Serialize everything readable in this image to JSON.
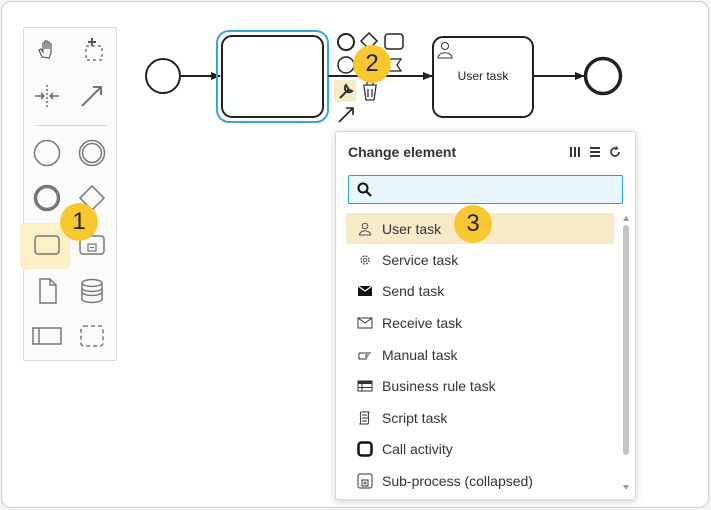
{
  "palette": {
    "tools": [
      {
        "name": "hand-tool",
        "icon": "hand-icon"
      },
      {
        "name": "lasso-tool",
        "icon": "lasso-icon"
      },
      {
        "name": "space-tool",
        "icon": "space-icon"
      },
      {
        "name": "connect-tool",
        "icon": "arrow-icon"
      },
      {
        "name": "start-event-tool",
        "icon": "circle-icon"
      },
      {
        "name": "intermediate-event-tool",
        "icon": "double-circle-icon"
      },
      {
        "name": "end-event-tool",
        "icon": "bold-circle-icon"
      },
      {
        "name": "gateway-tool",
        "icon": "diamond-icon"
      },
      {
        "name": "task-tool",
        "icon": "rounded-rect-icon"
      },
      {
        "name": "subprocess-tool",
        "icon": "collapsed-subprocess-icon"
      },
      {
        "name": "data-object-tool",
        "icon": "document-icon"
      },
      {
        "name": "data-store-tool",
        "icon": "database-icon"
      },
      {
        "name": "pool-tool",
        "icon": "pool-icon"
      },
      {
        "name": "group-tool",
        "icon": "group-icon"
      }
    ]
  },
  "callouts": {
    "one": "1",
    "two": "2",
    "three": "3"
  },
  "diagram": {
    "user_task_label": "User task"
  },
  "menu": {
    "title": "Change element",
    "search_value": "",
    "entries": [
      {
        "label": "User task",
        "icon": "user-icon",
        "selected": true
      },
      {
        "label": "Service task",
        "icon": "gear-icon"
      },
      {
        "label": "Send task",
        "icon": "envelope-filled-icon"
      },
      {
        "label": "Receive task",
        "icon": "envelope-icon"
      },
      {
        "label": "Manual task",
        "icon": "hand-icon"
      },
      {
        "label": "Business rule task",
        "icon": "table-icon"
      },
      {
        "label": "Script task",
        "icon": "script-icon"
      },
      {
        "label": "Call activity",
        "icon": "bold-rect-icon"
      },
      {
        "label": "Sub-process (collapsed)",
        "icon": "subprocess-icon"
      }
    ]
  },
  "colors": {
    "accent": "#2a9dcf",
    "highlight": "#f8ebc9",
    "callout": "#f8c82e"
  }
}
